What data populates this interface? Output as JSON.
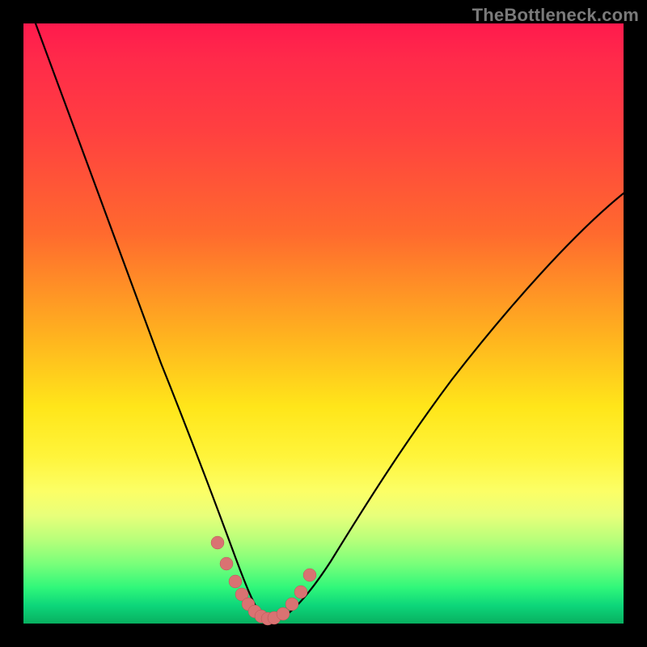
{
  "watermark": "TheBottleneck.com",
  "colors": {
    "frame": "#000000",
    "curve": "#000000",
    "marker": "#d97272",
    "gradient_top": "#ff1a4d",
    "gradient_mid": "#ffe61a",
    "gradient_bottom": "#08b060"
  },
  "chart_data": {
    "type": "line",
    "title": "",
    "xlabel": "",
    "ylabel": "",
    "xlim": [
      0,
      100
    ],
    "ylim": [
      0,
      100
    ],
    "series": [
      {
        "name": "bottleneck-curve",
        "x": [
          2,
          5,
          8,
          11,
          14,
          17,
          20,
          23,
          26,
          29,
          31.5,
          33,
          34.5,
          36,
          37,
          38,
          39.5,
          41,
          42.5,
          45,
          48,
          52,
          57,
          63,
          70,
          78,
          87,
          97,
          100
        ],
        "y": [
          100,
          90,
          80,
          70,
          61,
          52,
          44,
          36,
          28,
          21,
          15,
          11,
          8,
          5.5,
          3.5,
          2,
          1,
          0.5,
          0.7,
          2,
          5,
          10,
          17,
          26,
          36,
          47,
          58,
          69,
          72
        ]
      }
    ],
    "markers": {
      "name": "highlight-points",
      "x": [
        32.0,
        33.5,
        35.0,
        36.0,
        37.0,
        38.0,
        39.0,
        40.0,
        41.0,
        42.5,
        44.0,
        45.5,
        47.0
      ],
      "y": [
        13.0,
        9.5,
        6.5,
        4.5,
        3.0,
        2.0,
        1.2,
        0.8,
        0.9,
        1.5,
        3.0,
        5.0,
        8.0
      ]
    }
  }
}
